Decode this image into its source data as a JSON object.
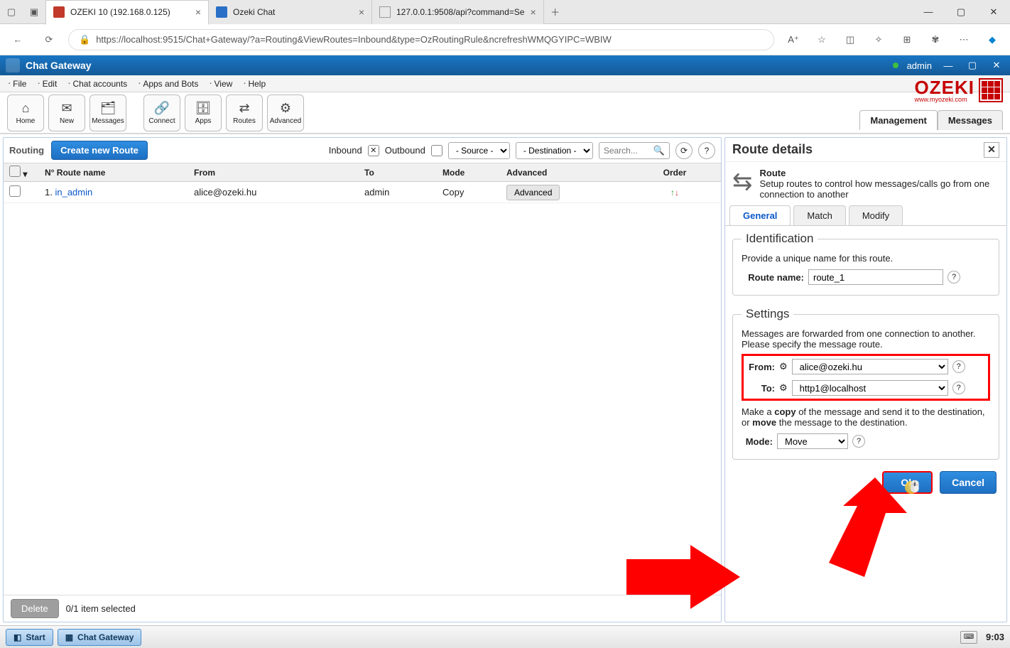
{
  "browser": {
    "tabs": [
      {
        "title": "OZEKI 10 (192.168.0.125)"
      },
      {
        "title": "Ozeki Chat"
      },
      {
        "title": "127.0.0.1:9508/api?command=Se"
      }
    ],
    "url": "https://localhost:9515/Chat+Gateway/?a=Routing&ViewRoutes=Inbound&type=OzRoutingRule&ncrefreshWMQGYIPC=WBIW"
  },
  "app": {
    "title": "Chat Gateway",
    "user": "admin",
    "logo_text": "OZEKI",
    "logo_sub": "www.myozeki.com"
  },
  "menubar": [
    "File",
    "Edit",
    "Chat accounts",
    "Apps and Bots",
    "View",
    "Help"
  ],
  "toolbar": [
    {
      "label": "Home"
    },
    {
      "label": "New"
    },
    {
      "label": "Messages"
    },
    {
      "label": "Connect"
    },
    {
      "label": "Apps"
    },
    {
      "label": "Routes"
    },
    {
      "label": "Advanced"
    }
  ],
  "view_tabs": {
    "management": "Management",
    "messages": "Messages"
  },
  "left": {
    "heading": "Routing",
    "create_btn": "Create new Route",
    "filter_inbound": "Inbound",
    "filter_outbound": "Outbound",
    "source_placeholder": "- Source -",
    "dest_placeholder": "- Destination -",
    "search_placeholder": "Search...",
    "columns": {
      "no": "N° Route name",
      "from": "From",
      "to": "To",
      "mode": "Mode",
      "advanced": "Advanced",
      "order": "Order"
    },
    "rows": [
      {
        "idx": "1.",
        "name": "in_admin",
        "from": "alice@ozeki.hu",
        "to": "admin",
        "mode": "Copy",
        "adv": "Advanced"
      }
    ],
    "delete_btn": "Delete",
    "selection": "0/1 item selected"
  },
  "details": {
    "title": "Route details",
    "route_hdr": "Route",
    "route_desc": "Setup routes to control how messages/calls go from one connection to another",
    "tabs": {
      "general": "General",
      "match": "Match",
      "modify": "Modify"
    },
    "ident": {
      "legend": "Identification",
      "hint": "Provide a unique name for this route.",
      "name_label": "Route name:",
      "name_value": "route_1"
    },
    "settings": {
      "legend": "Settings",
      "hint": "Messages are forwarded from one connection to another. Please specify the message route.",
      "from_label": "From:",
      "from_value": "alice@ozeki.hu",
      "to_label": "To:",
      "to_value": "http1@localhost",
      "copy_text_a": "Make a ",
      "copy_bold": "copy",
      "copy_text_b": " of the message and send it to the destination, or ",
      "move_bold": "move",
      "copy_text_c": " the message to the destination.",
      "mode_label": "Mode:",
      "mode_value": "Move"
    },
    "ok": "Ok",
    "cancel": "Cancel"
  },
  "taskbar": {
    "start": "Start",
    "app": "Chat Gateway",
    "time": "9:03"
  }
}
